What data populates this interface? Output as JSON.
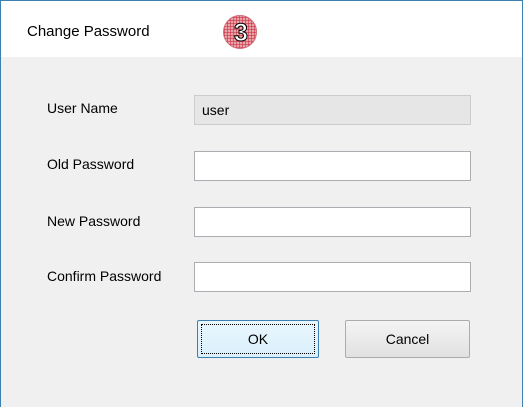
{
  "window": {
    "title": "Change Password",
    "step_badge": "3"
  },
  "form": {
    "user_name_label": "User Name",
    "user_name_value": "user",
    "old_password_label": "Old Password",
    "old_password_value": "",
    "new_password_label": "New Password",
    "new_password_value": "",
    "confirm_password_label": "Confirm Password",
    "confirm_password_value": ""
  },
  "buttons": {
    "ok_label": "OK",
    "cancel_label": "Cancel"
  },
  "colors": {
    "window_border": "#3c7fb1",
    "dialog_background": "#f0f0f0",
    "badge_fill": "#e8a3a8"
  }
}
